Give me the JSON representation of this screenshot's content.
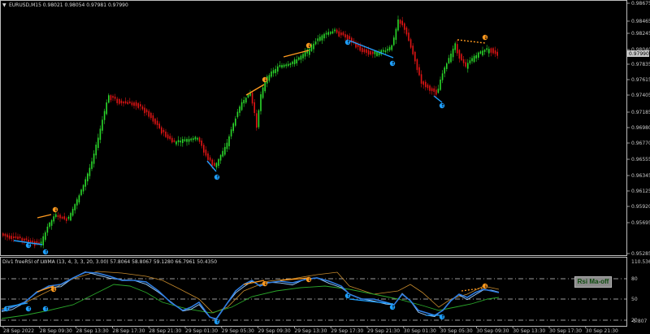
{
  "chart": {
    "header": "EURUSD,M15  0.98021 0.98054 0.97981 0.97990",
    "current_price_tag": "0.97990",
    "price_axis": [
      "0.98675",
      "0.98465",
      "0.98245",
      "0.98040",
      "0.97835",
      "0.97615",
      "0.97405",
      "0.97185",
      "0.96980",
      "0.96770",
      "0.96555",
      "0.96345",
      "0.96125",
      "0.95920",
      "0.95695",
      "0.95285"
    ],
    "colors": {
      "bull": "#2bd92b",
      "bear": "#e01414",
      "up_div": "#ff9a1f",
      "down_div": "#1fa0ff",
      "frame": "#c8c8c8"
    }
  },
  "indicator": {
    "header": "Div1 freeRSI of LWMA (13, 4, 3, 3, 20, 3.00) 57.8064 58.8067 59.1280 66.7961 50.4350",
    "axis": [
      "110.5365",
      "80",
      "50",
      "20",
      "-5.807"
    ],
    "button_label": "Rsi Ma-off",
    "colors": {
      "rsi": "#2f7de0",
      "signal": "#9fd0ff",
      "slow": "#c68a2c",
      "ma": "#2aa62a"
    }
  },
  "time_axis": [
    "28 Sep 2022",
    "28 Sep 09:30",
    "28 Sep 13:30",
    "28 Sep 17:30",
    "28 Sep 21:30",
    "29 Sep 01:30",
    "29 Sep 05:30",
    "29 Sep 09:30",
    "29 Sep 13:30",
    "29 Sep 17:30",
    "29 Sep 21:30",
    "30 Sep 01:30",
    "30 Sep 05:30",
    "30 Sep 09:30",
    "30 Sep 13:30",
    "30 Sep 17:30",
    "30 Sep 21:30"
  ]
}
